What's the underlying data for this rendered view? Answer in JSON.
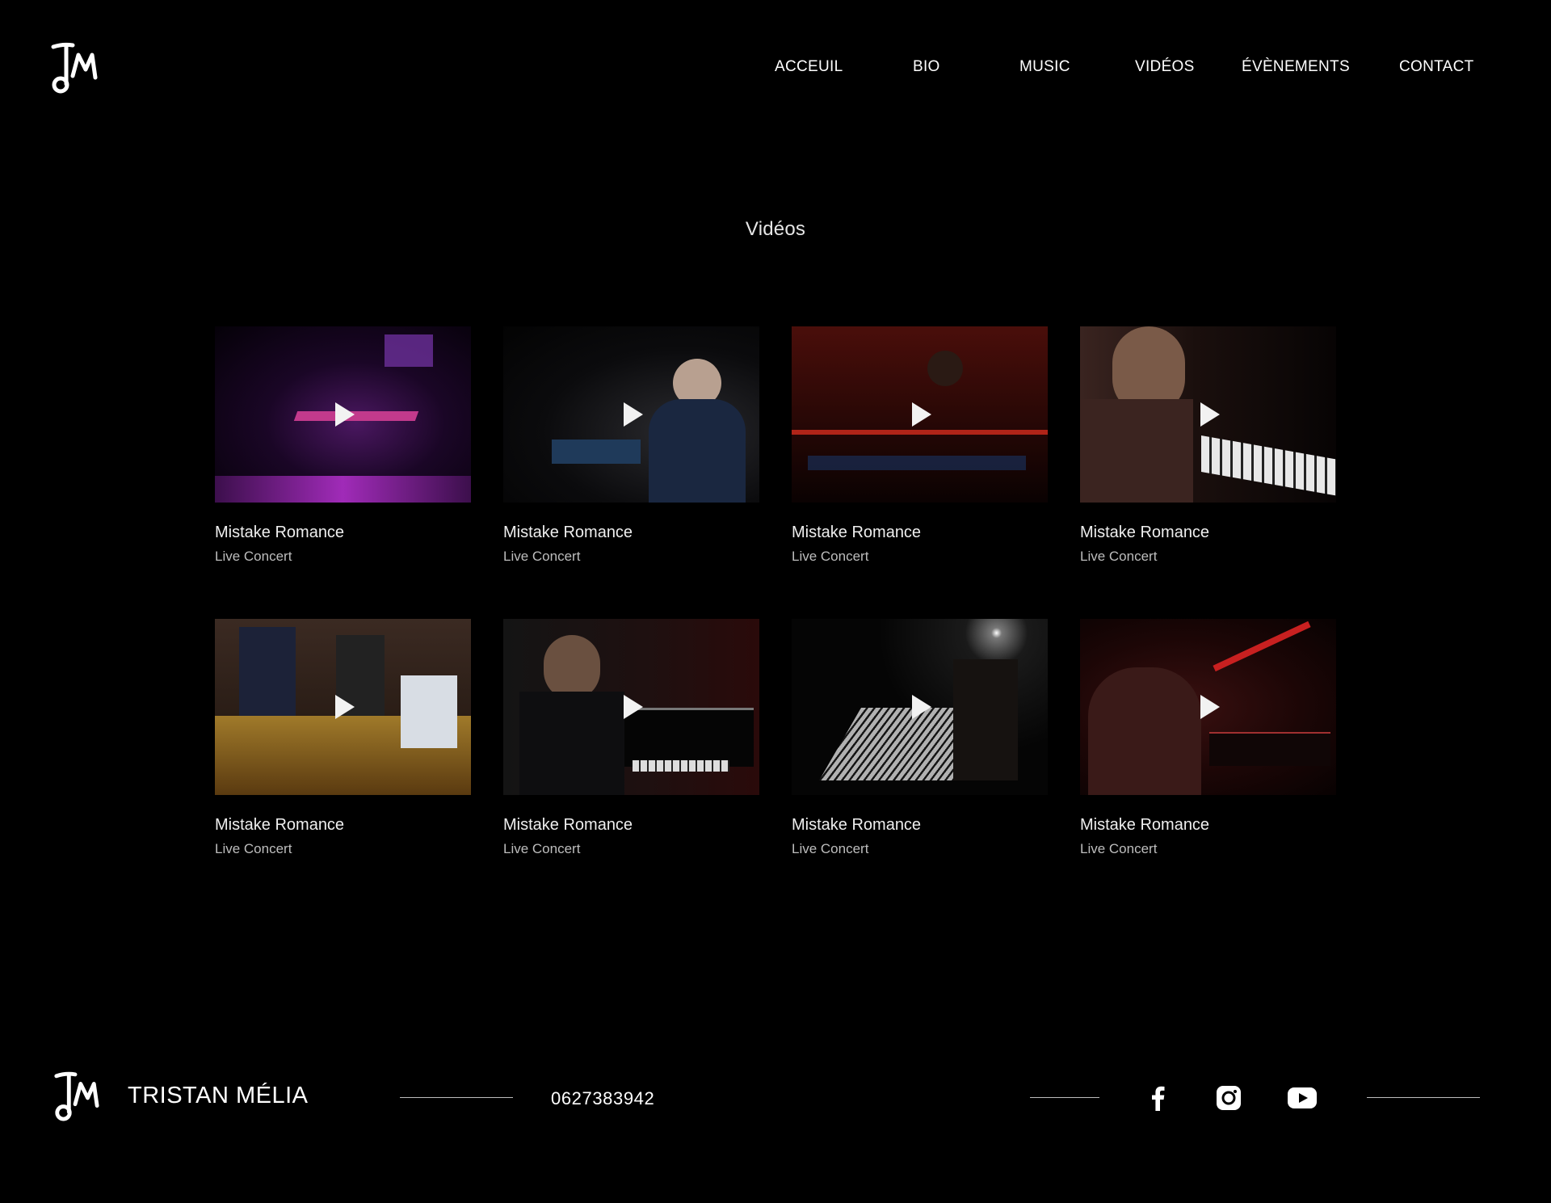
{
  "brand": {
    "name": "TRISTAN MÉLIA",
    "logo": "tm-monogram-logo"
  },
  "nav": {
    "items": [
      {
        "label": "ACCEUIL"
      },
      {
        "label": "BIO"
      },
      {
        "label": "MUSIC"
      },
      {
        "label": "VIDÉOS"
      },
      {
        "label": "ÉVÈNEMENTS"
      },
      {
        "label": "CONTACT"
      }
    ]
  },
  "main": {
    "title": "Vidéos",
    "videos": [
      {
        "title": "Mistake Romance",
        "subtitle": "Live Concert"
      },
      {
        "title": "Mistake Romance",
        "subtitle": "Live Concert"
      },
      {
        "title": "Mistake Romance",
        "subtitle": "Live Concert"
      },
      {
        "title": "Mistake Romance",
        "subtitle": "Live Concert"
      },
      {
        "title": "Mistake Romance",
        "subtitle": "Live Concert"
      },
      {
        "title": "Mistake Romance",
        "subtitle": "Live Concert"
      },
      {
        "title": "Mistake Romance",
        "subtitle": "Live Concert"
      },
      {
        "title": "Mistake Romance",
        "subtitle": "Live Concert"
      }
    ]
  },
  "footer": {
    "name": "TRISTAN MÉLIA",
    "phone": "0627383942",
    "social": [
      "facebook-icon",
      "instagram-icon",
      "youtube-icon"
    ]
  },
  "colors": {
    "background": "#000000",
    "text": "#ffffff",
    "muted": "#bdbdbd"
  }
}
